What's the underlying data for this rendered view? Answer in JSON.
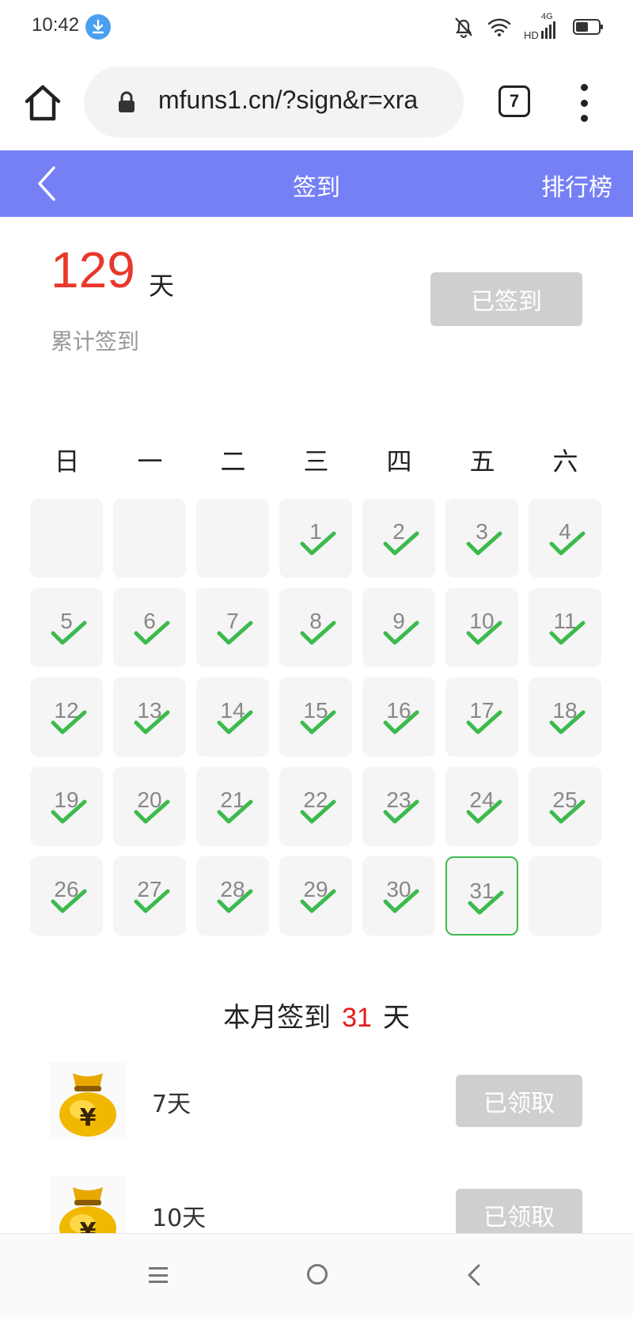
{
  "status_bar": {
    "time": "10:42",
    "network": "4G"
  },
  "browser": {
    "url": "mfuns1.cn/?sign&r=xra",
    "tab_count": "7"
  },
  "header": {
    "title": "签到",
    "rank_label": "排行榜",
    "background": "#7680f5"
  },
  "summary": {
    "total_days": "129",
    "unit": "天",
    "label": "累计签到",
    "signed_button": "已签到"
  },
  "calendar": {
    "weekdays": [
      "日",
      "一",
      "二",
      "三",
      "四",
      "五",
      "六"
    ],
    "leading_blanks": 3,
    "days_in_month": 31,
    "checked_through": 31,
    "today": 31,
    "check_color": "#3dba4d"
  },
  "month_summary": {
    "prefix": "本月签到",
    "count": "31",
    "suffix": "天"
  },
  "rewards": [
    {
      "label": "7天",
      "button": "已领取",
      "icon": "money-bag-icon"
    },
    {
      "label": "10天",
      "button": "已领取",
      "icon": "money-bag-icon"
    }
  ]
}
